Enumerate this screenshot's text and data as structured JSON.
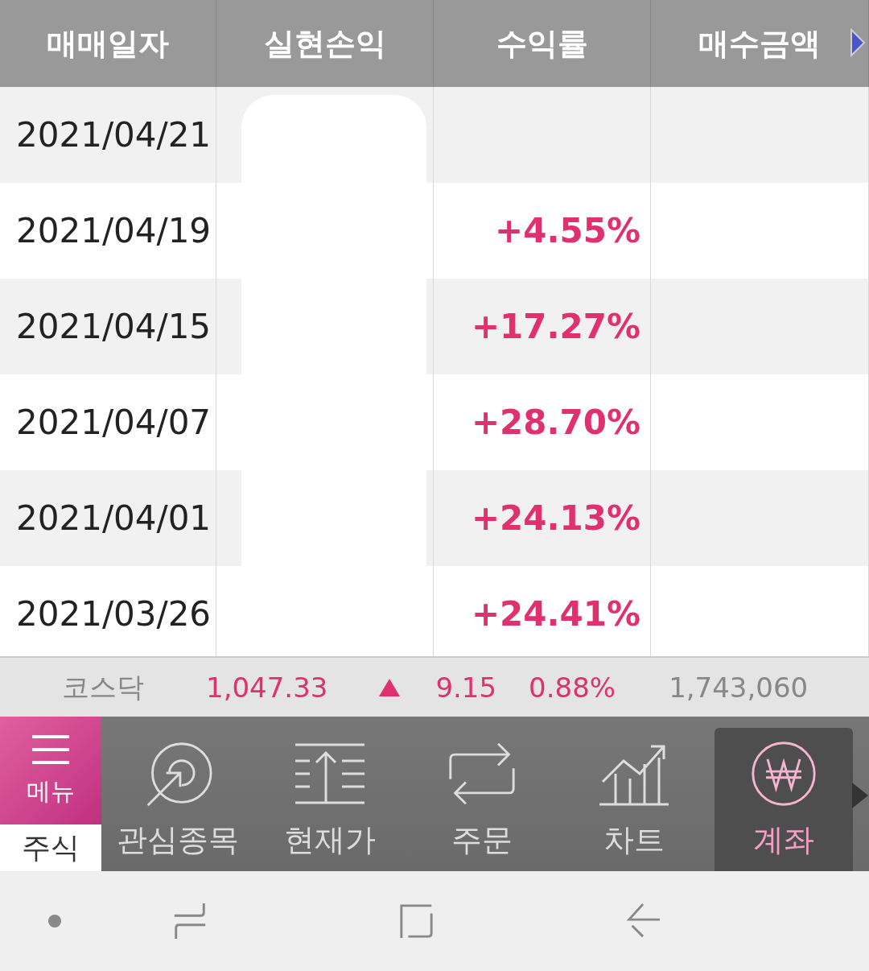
{
  "table": {
    "columns": [
      "매매일자",
      "실현손익",
      "수익률",
      "매수금액"
    ],
    "rows": [
      {
        "date": "2021/04/21"
      },
      {
        "date": "2021/04/19",
        "return": "+4.55%"
      },
      {
        "date": "2021/04/15",
        "return": "+17.27%"
      },
      {
        "date": "2021/04/07",
        "return": "+28.70%"
      },
      {
        "date": "2021/04/01",
        "return": "+24.13%"
      },
      {
        "date": "2021/03/26",
        "return": "+24.41%"
      }
    ]
  },
  "ticker": {
    "name": "코스닥",
    "price": "1,047.33",
    "change": "9.15",
    "percent": "0.88%",
    "volume": "1,743,060"
  },
  "menu": {
    "label": "메뉴",
    "section": "주식"
  },
  "nav": [
    {
      "label": "관심종목",
      "kind": "target",
      "selected": false
    },
    {
      "label": "현재가",
      "kind": "price",
      "selected": false
    },
    {
      "label": "주문",
      "kind": "order",
      "selected": false
    },
    {
      "label": "차트",
      "kind": "chart",
      "selected": false
    },
    {
      "label": "계좌",
      "kind": "won",
      "selected": true
    }
  ]
}
